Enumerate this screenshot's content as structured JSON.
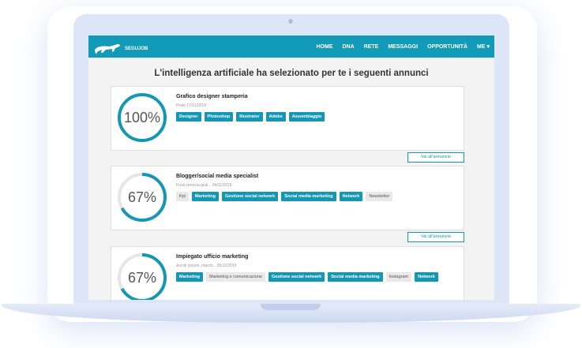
{
  "nav": {
    "logo_text": "SEGUJOB",
    "links": [
      "HOME",
      "DNA",
      "RETE",
      "MESSAGGI",
      "OPPORTUNITÀ",
      "ME ▾"
    ]
  },
  "headline": "L'intelligenza artificiale ha selezionato per te i seguenti annunci",
  "view_label": "Vai all'annuncio",
  "jobs": [
    {
      "match": "100%",
      "match_value": 100,
      "title": "Grafico designer stamperia",
      "meta": "Prato 17/11/2019",
      "tags": [
        {
          "label": "Designer",
          "match": true
        },
        {
          "label": "Photoshop",
          "match": true
        },
        {
          "label": "Illustrator",
          "match": true
        },
        {
          "label": "Adobe",
          "match": true
        },
        {
          "label": "Assemblaggio",
          "match": true
        }
      ]
    },
    {
      "match": "67%",
      "match_value": 67,
      "title": "Blogger/social media specialist",
      "meta": "Friuli-venezia-giuli... 04/11/2019",
      "tags": [
        {
          "label": "Kpi",
          "match": false
        },
        {
          "label": "Marketing",
          "match": true
        },
        {
          "label": "Gestione social network",
          "match": true
        },
        {
          "label": "Social media marketing",
          "match": true
        },
        {
          "label": "Network",
          "match": true
        },
        {
          "label": "Newsletter",
          "match": false
        }
      ]
    },
    {
      "match": "67%",
      "match_value": 67,
      "title": "Impiegato ufficio marketing",
      "meta": "Ascoli piceno, march... 05/11/2019",
      "tags": [
        {
          "label": "Marketing",
          "match": true
        },
        {
          "label": "Marketing e comunicazione",
          "match": false
        },
        {
          "label": "Gestione social network",
          "match": true
        },
        {
          "label": "Social media marketing",
          "match": true
        },
        {
          "label": "Instagram",
          "match": false
        },
        {
          "label": "Network",
          "match": true
        }
      ]
    }
  ],
  "colors": {
    "accent": "#1497b5",
    "navbar": "#119bb8",
    "ring_track": "#e6e6e6"
  }
}
